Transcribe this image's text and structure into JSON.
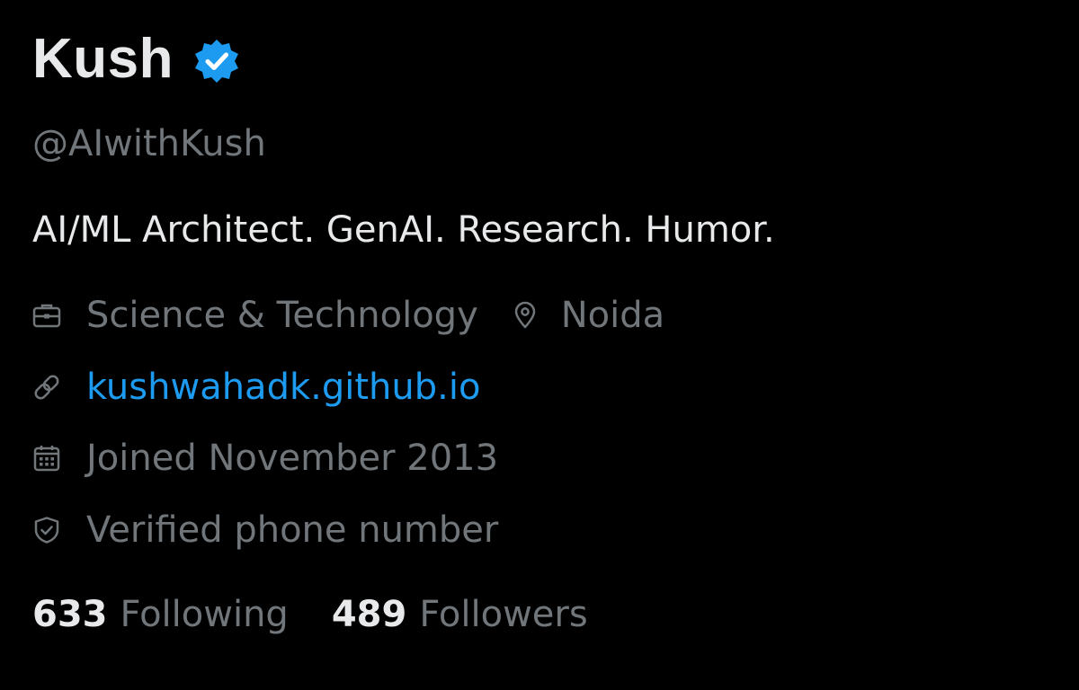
{
  "profile": {
    "display_name": "Kush",
    "handle": "@AIwithKush",
    "bio": "AI/ML Architect. GenAI. Research. Humor.",
    "category": "Science & Technology",
    "location": "Noida",
    "website": "kushwahadk.github.io",
    "joined": "Joined November 2013",
    "phone_status": "Verified phone number"
  },
  "stats": {
    "following_count": "633",
    "following_label": "Following",
    "followers_count": "489",
    "followers_label": "Followers"
  },
  "icons": {
    "verified": "verified-badge-icon",
    "category": "briefcase-icon",
    "location": "location-pin-icon",
    "website": "link-icon",
    "joined": "calendar-icon",
    "phone": "shield-check-icon"
  },
  "colors": {
    "background": "#000000",
    "primary_text": "#e7e9ea",
    "secondary_text": "#71767b",
    "link": "#1d9bf0",
    "verified_badge": "#1d9bf0"
  }
}
